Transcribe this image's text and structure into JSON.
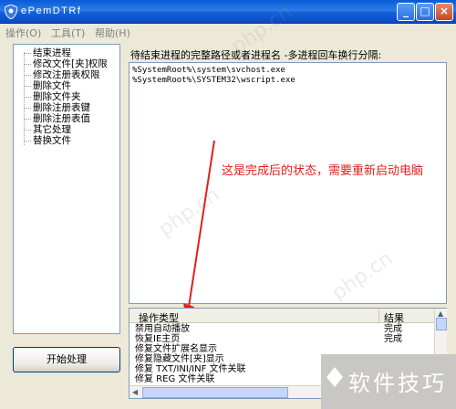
{
  "window": {
    "title": "ePemDTRf"
  },
  "menu": {
    "items": [
      {
        "label": "操作(O)"
      },
      {
        "label": "工具(T)"
      },
      {
        "label": "帮助(H)"
      }
    ]
  },
  "sidebar": {
    "items": [
      {
        "label": "结束进程"
      },
      {
        "label": "修改文件[夹]权限"
      },
      {
        "label": "修改注册表权限"
      },
      {
        "label": "删除文件"
      },
      {
        "label": "删除文件夹"
      },
      {
        "label": "删除注册表键"
      },
      {
        "label": "删除注册表值"
      },
      {
        "label": "其它处理"
      },
      {
        "label": "替换文件"
      }
    ]
  },
  "main": {
    "prompt": "待结束进程的完整路径或者进程名 -多进程回车换行分隔:",
    "paths": [
      "%SystemRoot%\\system\\svchost.exe",
      "%SystemRoot%\\SYSTEM32\\wscript.exe"
    ]
  },
  "annotation": {
    "text": "这是完成后的状态，需要重新启动电脑",
    "color": "#e0201a"
  },
  "results": {
    "columns": [
      "操作类型",
      "结果"
    ],
    "rows": [
      {
        "op": "禁用自动播放",
        "result": "完成"
      },
      {
        "op": "恢复IE主页",
        "result": "完成"
      },
      {
        "op": "修复文件扩展名显示",
        "result": ""
      },
      {
        "op": "修复隐藏文件[夹]显示",
        "result": ""
      },
      {
        "op": "修复 TXT/INI/INF 文件关联",
        "result": ""
      },
      {
        "op": "修复 REG 文件关联",
        "result": ""
      }
    ]
  },
  "actions": {
    "start_label": "开始处理"
  },
  "watermark": {
    "text": "软件技巧",
    "diagonal_text": "php.cn"
  }
}
